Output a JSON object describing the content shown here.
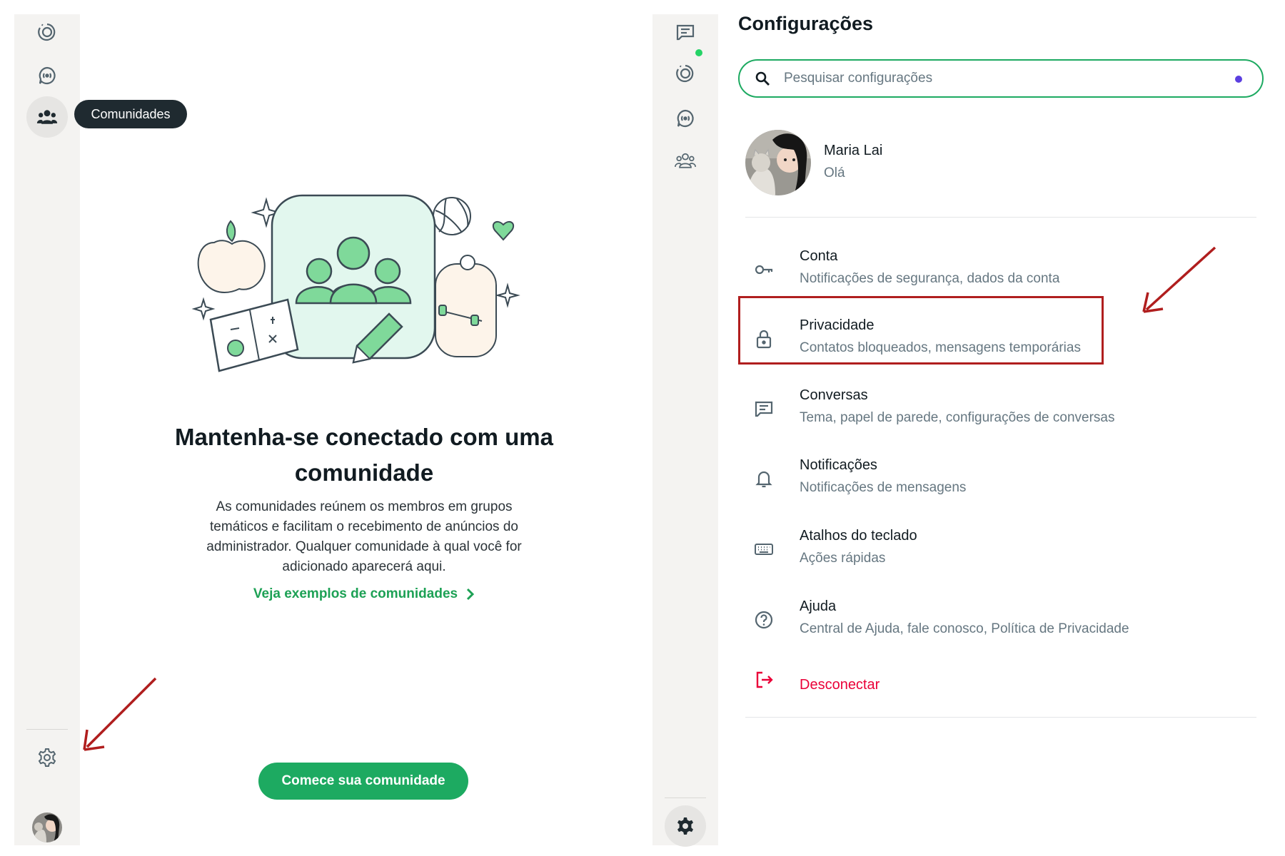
{
  "left_panel": {
    "tooltip": "Comunidades",
    "title": "Mantenha-se conectado com uma comunidade",
    "description": "As comunidades reúnem os membros em grupos temáticos e facilitam o recebimento de anúncios do administrador. Qualquer comunidade à qual você for adicionado aparecerá aqui.",
    "link": "Veja exemplos de comunidades",
    "button": "Comece sua comunidade"
  },
  "settings": {
    "title": "Configurações",
    "search_placeholder": "Pesquisar configurações",
    "profile": {
      "name": "Maria Lai",
      "status": "Olá"
    },
    "items": [
      {
        "title": "Conta",
        "subtitle": "Notificações de segurança, dados da conta",
        "icon": "key-icon"
      },
      {
        "title": "Privacidade",
        "subtitle": "Contatos bloqueados, mensagens temporárias",
        "icon": "lock-icon"
      },
      {
        "title": "Conversas",
        "subtitle": "Tema, papel de parede, configurações de conversas",
        "icon": "chat-icon"
      },
      {
        "title": "Notificações",
        "subtitle": "Notificações de mensagens",
        "icon": "bell-icon"
      },
      {
        "title": "Atalhos do teclado",
        "subtitle": "Ações rápidas",
        "icon": "keyboard-icon"
      },
      {
        "title": "Ajuda",
        "subtitle": "Central de Ajuda, fale conosco, Política de Privacidade",
        "icon": "help-icon"
      }
    ],
    "logout": "Desconectar"
  },
  "colors": {
    "accent": "#1daa61",
    "danger": "#ea0038",
    "annotation": "#b01e1e"
  }
}
